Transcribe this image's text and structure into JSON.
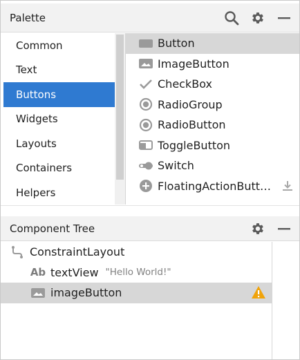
{
  "palette": {
    "title": "Palette",
    "tools": {
      "search_icon": "search-icon",
      "settings_icon": "gear-icon",
      "hide_icon": "minimize-icon"
    },
    "categories": [
      "Common",
      "Text",
      "Buttons",
      "Widgets",
      "Layouts",
      "Containers",
      "Helpers"
    ],
    "selected_category": "Buttons",
    "items": [
      {
        "label": "Button",
        "icon": "button-icon",
        "selected": true
      },
      {
        "label": "ImageButton",
        "icon": "image-button-icon"
      },
      {
        "label": "CheckBox",
        "icon": "checkmark-icon"
      },
      {
        "label": "RadioGroup",
        "icon": "radio-icon"
      },
      {
        "label": "RadioButton",
        "icon": "radio-icon"
      },
      {
        "label": "ToggleButton",
        "icon": "toggle-button-icon"
      },
      {
        "label": "Switch",
        "icon": "switch-icon"
      },
      {
        "label": "FloatingActionButt…",
        "icon": "plus-circle-icon",
        "download_icon": "download-icon"
      }
    ]
  },
  "component_tree": {
    "title": "Component Tree",
    "tools": {
      "settings_icon": "gear-icon",
      "hide_icon": "minimize-icon"
    },
    "nodes": [
      {
        "label": "ConstraintLayout",
        "icon": "constraint-layout-icon"
      },
      {
        "label": "textView",
        "hint": "\"Hello World!\"",
        "icon": "text-ab-icon",
        "icon_text": "Ab"
      },
      {
        "label": "imageButton",
        "icon": "image-button-icon",
        "selected": true,
        "warning_icon": "warning-icon"
      }
    ]
  },
  "colors": {
    "selection_blue": "#2f7ad1",
    "selected_row": "#d7d7d7",
    "icon_gray": "#9a9a9a",
    "warning": "#f0a30a"
  }
}
